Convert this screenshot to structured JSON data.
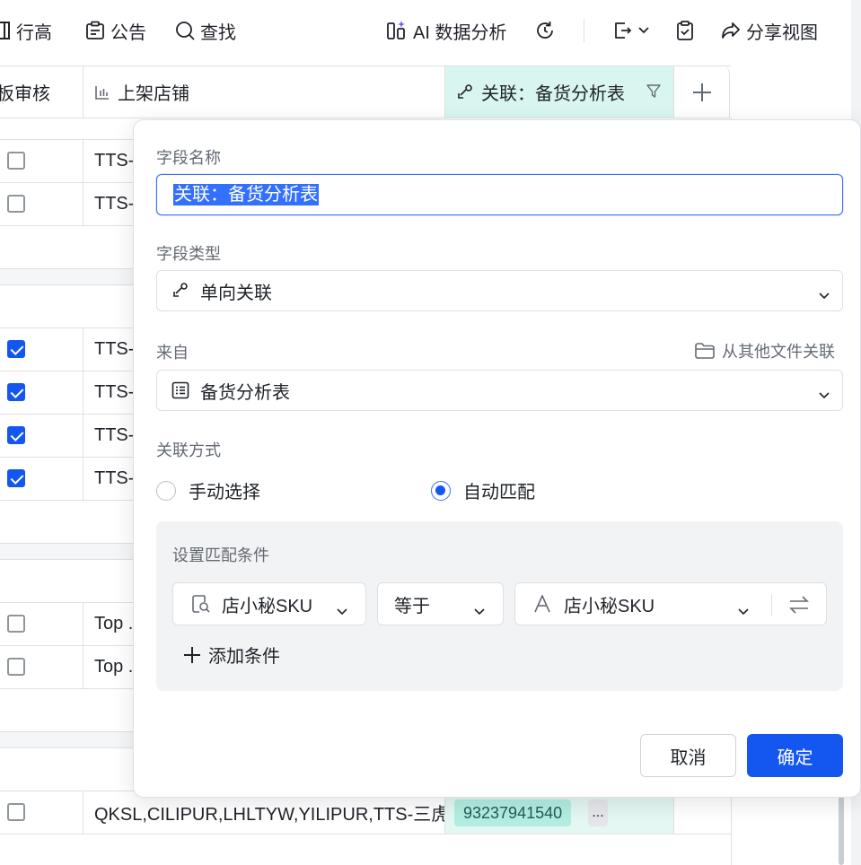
{
  "toolbar": {
    "row_height": "行高",
    "announcement": "公告",
    "search": "查找",
    "ai_analysis": "AI 数据分析",
    "share_view": "分享视图"
  },
  "table": {
    "columns": [
      "板审核",
      "上架店铺",
      "关联：备货分析表"
    ],
    "rows": [
      {
        "checked": false,
        "shop": "TTS-"
      },
      {
        "checked": false,
        "shop": "TTS-"
      },
      {
        "checked": true,
        "shop": "TTS-"
      },
      {
        "checked": true,
        "shop": "TTS-"
      },
      {
        "checked": true,
        "shop": "TTS-"
      },
      {
        "checked": true,
        "shop": "TTS-"
      },
      {
        "checked": false,
        "shop": "Top ."
      },
      {
        "checked": false,
        "shop": "Top ."
      },
      {
        "checked": false,
        "shop": "QKSL,CILIPUR,LHLTYW,YILIPUR,TTS-三虎",
        "link_value": "93237941540",
        "link_more": "..."
      }
    ]
  },
  "dialog": {
    "field_name_label": "字段名称",
    "field_name_value": "关联：备货分析表",
    "field_type_label": "字段类型",
    "field_type_value": "单向关联",
    "from_label": "来自",
    "from_other_file": "从其他文件关联",
    "from_value": "备货分析表",
    "link_mode_label": "关联方式",
    "mode_manual": "手动选择",
    "mode_auto": "自动匹配",
    "selected_mode": "自动匹配",
    "conditions_title": "设置匹配条件",
    "condition": {
      "left_field": "店小秘SKU",
      "operator": "等于",
      "right_field": "店小秘SKU"
    },
    "add_condition": "添加条件",
    "cancel": "取消",
    "confirm": "确定"
  },
  "colors": {
    "primary": "#1456f0",
    "link_column_bg": "#d9f5ef",
    "link_tag_bg": "#b3ede1"
  }
}
